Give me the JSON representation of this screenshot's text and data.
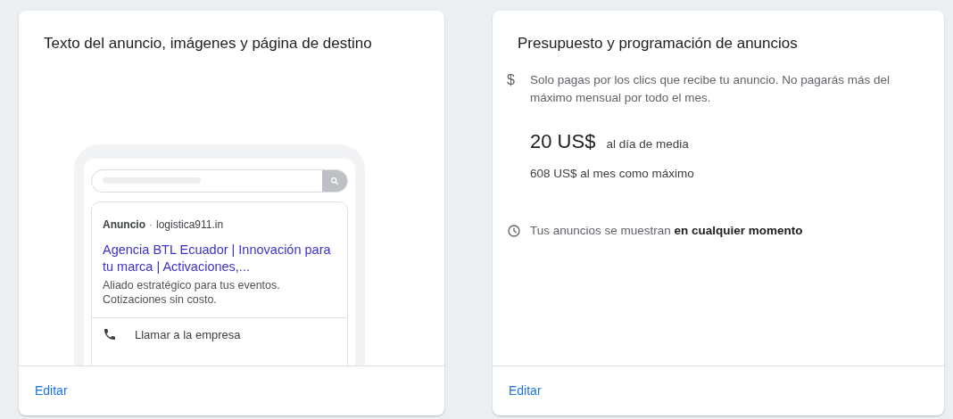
{
  "cards": [
    {
      "kind": "ad_preview",
      "title": "Texto del anuncio, imágenes y página de destino",
      "ad": {
        "label": "Anuncio",
        "separator": "·",
        "domain": "logistica911.in",
        "headline": "Agencia BTL Ecuador | Innovación para tu marca | Activaciones,...",
        "description": "Aliado estratégico para tus eventos. Cotizaciones sin costo.",
        "call_action": "Llamar a la empresa"
      },
      "edit_link": "Editar"
    },
    {
      "kind": "budget",
      "title": "Presupuesto y programación de anuncios",
      "currency_icon": "$",
      "description": "Solo pagas por los clics que recibe tu anuncio. No pagarás más del máximo mensual por todo el mes.",
      "amount": "20 US$",
      "amount_note": "al día de media",
      "monthly_max": "608 US$ al mes como máximo",
      "schedule": "Tus anuncios se muestran **en cualquier momento**",
      "edit_link": "Editar"
    }
  ]
}
